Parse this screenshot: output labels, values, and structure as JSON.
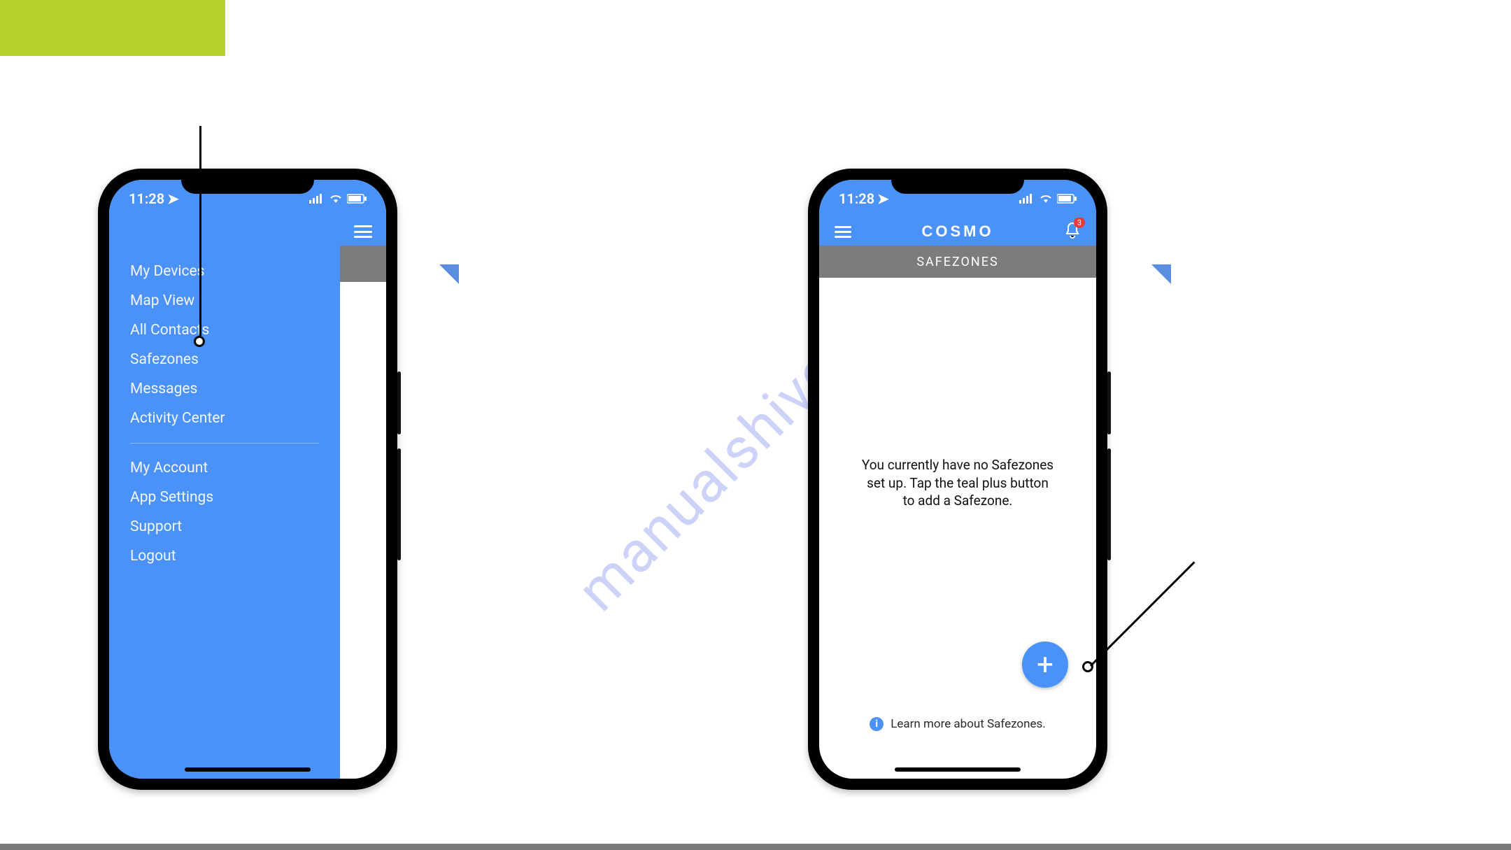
{
  "watermark": "manualshive.com",
  "status_bar": {
    "time": "11:28"
  },
  "phone1": {
    "menu_primary": [
      "My Devices",
      "Map View",
      "All Contacts",
      "Safezones",
      "Messages",
      "Activity Center"
    ],
    "menu_secondary": [
      "My Account",
      "App Settings",
      "Support",
      "Logout"
    ]
  },
  "phone2": {
    "brand": "COSMO",
    "notifications_count": "3",
    "section_title": "SAFEZONES",
    "empty_line1": "You currently have no Safezones",
    "empty_line2": "set up. Tap the teal plus button",
    "empty_line3": "to add a Safezone.",
    "fab_label": "+",
    "learn_more": "Learn more about Safezones.",
    "info_icon": "i"
  }
}
